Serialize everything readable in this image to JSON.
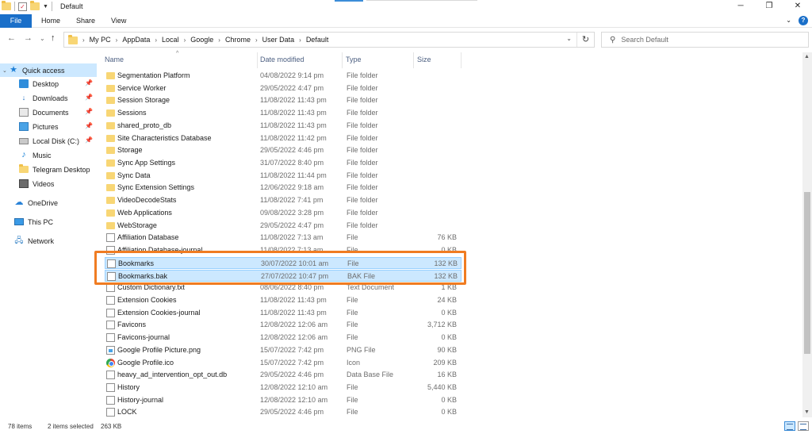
{
  "window": {
    "title": "Default"
  },
  "ribbon": {
    "tabs": [
      "File",
      "Home",
      "Share",
      "View"
    ]
  },
  "address": {
    "crumbs": [
      "My PC",
      "AppData",
      "Local",
      "Google",
      "Chrome",
      "User Data",
      "Default"
    ]
  },
  "search": {
    "placeholder": "Search Default"
  },
  "sidebar": {
    "items": [
      {
        "label": "Quick access",
        "icon": "star-icon",
        "pinned": false
      },
      {
        "label": "Desktop",
        "icon": "desktop-icon",
        "pinned": true
      },
      {
        "label": "Downloads",
        "icon": "download-icon",
        "pinned": true
      },
      {
        "label": "Documents",
        "icon": "documents-icon",
        "pinned": true
      },
      {
        "label": "Pictures",
        "icon": "pictures-icon",
        "pinned": true
      },
      {
        "label": "Local Disk (C:)",
        "icon": "disk-icon",
        "pinned": true
      },
      {
        "label": "Music",
        "icon": "music-icon",
        "pinned": false
      },
      {
        "label": "Telegram Desktop",
        "icon": "folder-icon",
        "pinned": false
      },
      {
        "label": "Videos",
        "icon": "videos-icon",
        "pinned": false
      },
      {
        "label": "OneDrive",
        "icon": "cloud-icon",
        "pinned": false
      },
      {
        "label": "This PC",
        "icon": "pc-icon",
        "pinned": false
      },
      {
        "label": "Network",
        "icon": "network-icon",
        "pinned": false
      }
    ]
  },
  "columns": {
    "name": "Name",
    "date": "Date modified",
    "type": "Type",
    "size": "Size"
  },
  "files": [
    {
      "name": "Segmentation Platform",
      "date": "04/08/2022 9:14 pm",
      "type": "File folder",
      "size": "",
      "icon": "folder"
    },
    {
      "name": "Service Worker",
      "date": "29/05/2022 4:47 pm",
      "type": "File folder",
      "size": "",
      "icon": "folder"
    },
    {
      "name": "Session Storage",
      "date": "11/08/2022 11:43 pm",
      "type": "File folder",
      "size": "",
      "icon": "folder"
    },
    {
      "name": "Sessions",
      "date": "11/08/2022 11:43 pm",
      "type": "File folder",
      "size": "",
      "icon": "folder"
    },
    {
      "name": "shared_proto_db",
      "date": "11/08/2022 11:43 pm",
      "type": "File folder",
      "size": "",
      "icon": "folder"
    },
    {
      "name": "Site Characteristics Database",
      "date": "11/08/2022 11:42 pm",
      "type": "File folder",
      "size": "",
      "icon": "folder"
    },
    {
      "name": "Storage",
      "date": "29/05/2022 4:46 pm",
      "type": "File folder",
      "size": "",
      "icon": "folder"
    },
    {
      "name": "Sync App Settings",
      "date": "31/07/2022 8:40 pm",
      "type": "File folder",
      "size": "",
      "icon": "folder"
    },
    {
      "name": "Sync Data",
      "date": "11/08/2022 11:44 pm",
      "type": "File folder",
      "size": "",
      "icon": "folder"
    },
    {
      "name": "Sync Extension Settings",
      "date": "12/06/2022 9:18 am",
      "type": "File folder",
      "size": "",
      "icon": "folder"
    },
    {
      "name": "VideoDecodeStats",
      "date": "11/08/2022 7:41 pm",
      "type": "File folder",
      "size": "",
      "icon": "folder"
    },
    {
      "name": "Web Applications",
      "date": "09/08/2022 3:28 pm",
      "type": "File folder",
      "size": "",
      "icon": "folder"
    },
    {
      "name": "WebStorage",
      "date": "29/05/2022 4:47 pm",
      "type": "File folder",
      "size": "",
      "icon": "folder"
    },
    {
      "name": "Affiliation Database",
      "date": "11/08/2022 7:13 am",
      "type": "File",
      "size": "76 KB",
      "icon": "file"
    },
    {
      "name": "Affiliation Database-journal",
      "date": "11/08/2022 7:13 am",
      "type": "File",
      "size": "0 KB",
      "icon": "file"
    },
    {
      "name": "Bookmarks",
      "date": "30/07/2022 10:01 am",
      "type": "File",
      "size": "132 KB",
      "icon": "file",
      "selected": true
    },
    {
      "name": "Bookmarks.bak",
      "date": "27/07/2022 10:47 pm",
      "type": "BAK File",
      "size": "132 KB",
      "icon": "file",
      "selected": true
    },
    {
      "name": "Custom Dictionary.txt",
      "date": "08/06/2022 8:40 pm",
      "type": "Text Document",
      "size": "1 KB",
      "icon": "file"
    },
    {
      "name": "Extension Cookies",
      "date": "11/08/2022 11:43 pm",
      "type": "File",
      "size": "24 KB",
      "icon": "file"
    },
    {
      "name": "Extension Cookies-journal",
      "date": "11/08/2022 11:43 pm",
      "type": "File",
      "size": "0 KB",
      "icon": "file"
    },
    {
      "name": "Favicons",
      "date": "12/08/2022 12:06 am",
      "type": "File",
      "size": "3,712 KB",
      "icon": "file"
    },
    {
      "name": "Favicons-journal",
      "date": "12/08/2022 12:06 am",
      "type": "File",
      "size": "0 KB",
      "icon": "file"
    },
    {
      "name": "Google Profile Picture.png",
      "date": "15/07/2022 7:42 pm",
      "type": "PNG File",
      "size": "90 KB",
      "icon": "png"
    },
    {
      "name": "Google Profile.ico",
      "date": "15/07/2022 7:42 pm",
      "type": "Icon",
      "size": "209 KB",
      "icon": "ico"
    },
    {
      "name": "heavy_ad_intervention_opt_out.db",
      "date": "29/05/2022 4:46 pm",
      "type": "Data Base File",
      "size": "16 KB",
      "icon": "file"
    },
    {
      "name": "History",
      "date": "12/08/2022 12:10 am",
      "type": "File",
      "size": "5,440 KB",
      "icon": "file"
    },
    {
      "name": "History-journal",
      "date": "12/08/2022 12:10 am",
      "type": "File",
      "size": "0 KB",
      "icon": "file"
    },
    {
      "name": "LOCK",
      "date": "29/05/2022 4:46 pm",
      "type": "File",
      "size": "0 KB",
      "icon": "file"
    }
  ],
  "status": {
    "count": "78 items",
    "selection": "2 items selected",
    "size": "263 KB"
  },
  "colors": {
    "selection": "#cce8ff",
    "highlight": "#f07c22",
    "accent": "#1a6fc9"
  }
}
